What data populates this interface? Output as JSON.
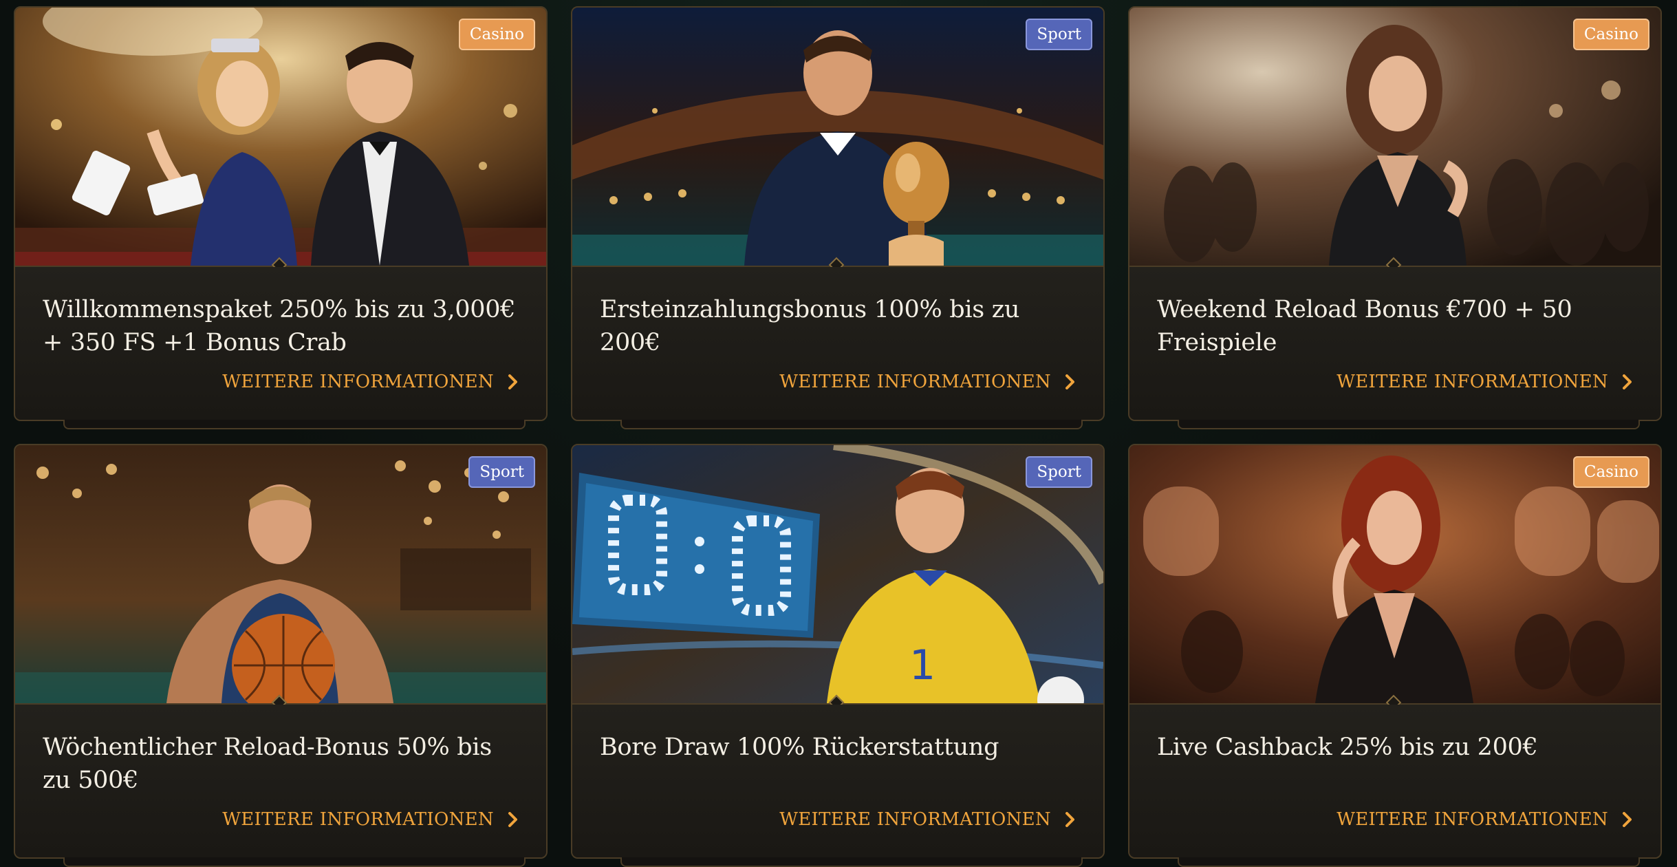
{
  "cards": [
    {
      "tag": "Casino",
      "title": "Willkommenspaket 250% bis zu 3,000€ + 350 FS +1 Bonus Crab",
      "cta": "WEITERE INFORMATIONEN"
    },
    {
      "tag": "Sport",
      "title": "Ersteinzahlungsbonus 100% bis zu 200€",
      "cta": "WEITERE INFORMATIONEN"
    },
    {
      "tag": "Casino",
      "title": "Weekend Reload Bonus €700 + 50 Freispiele",
      "cta": "WEITERE INFORMATIONEN"
    },
    {
      "tag": "Sport",
      "title": "Wöchentlicher Reload-Bonus 50% bis zu 500€",
      "cta": "WEITERE INFORMATIONEN"
    },
    {
      "tag": "Sport",
      "title": "Bore Draw 100% Rückerstattung",
      "cta": "WEITERE INFORMATIONEN"
    },
    {
      "tag": "Casino",
      "title": "Live Cashback 25% bis zu 200€",
      "cta": "WEITERE INFORMATIONEN"
    }
  ],
  "colors": {
    "casino_badge": "#e79a52",
    "sport_badge": "#5566b8",
    "cta_text": "#f0a43c",
    "card_border": "#4a3c26",
    "title_text": "#f4efe4"
  },
  "icons": {
    "cta": "chevron-right-icon"
  }
}
